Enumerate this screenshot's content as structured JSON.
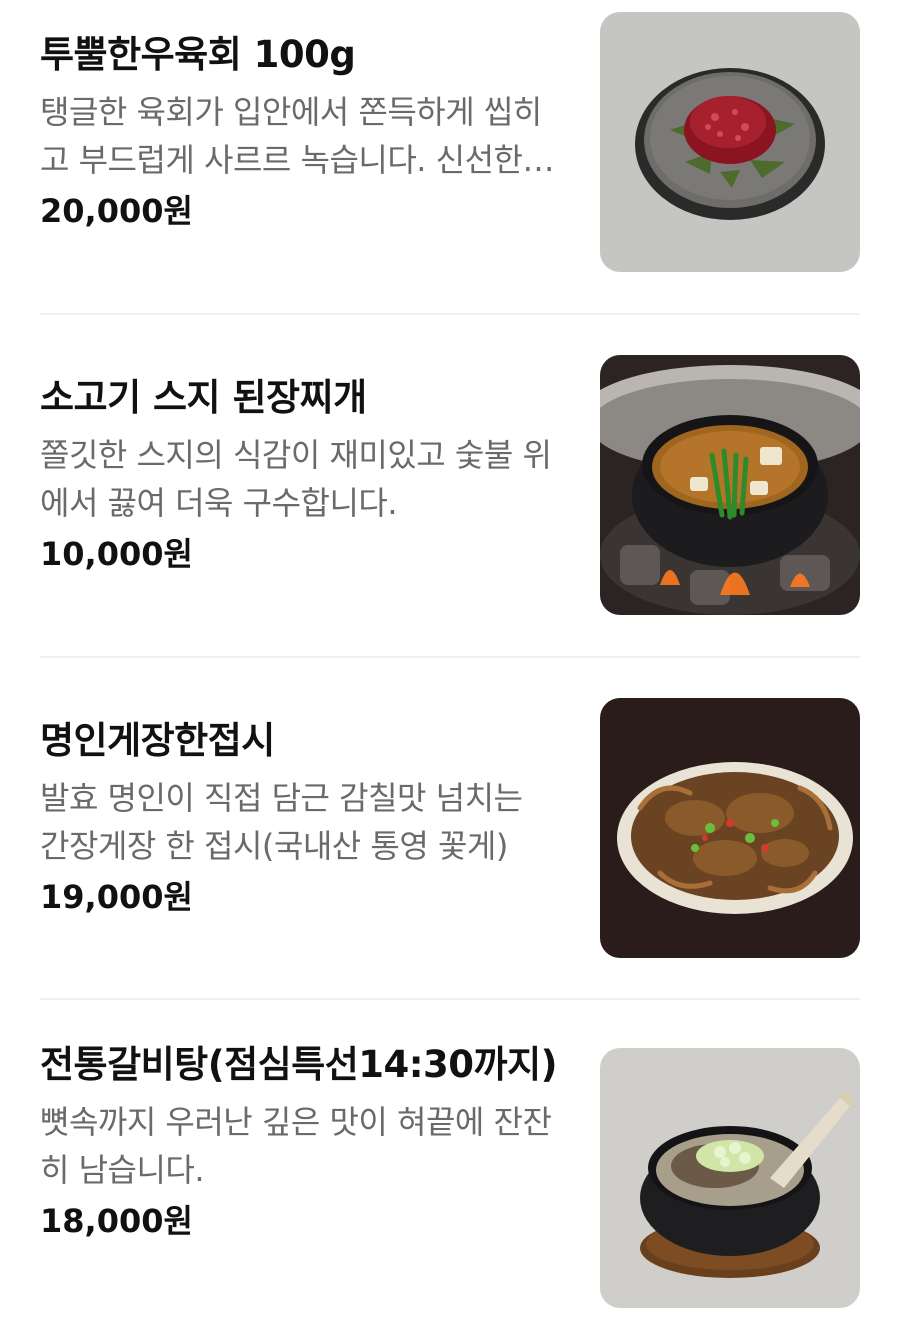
{
  "menu": {
    "items": [
      {
        "name": "투뿔한우육회 100g",
        "description": "탱글한 육회가 입안에서 쫀득하게 씹히고 부드럽게 사르르 녹습니다. 신선한 한우 육회",
        "price": "20,000원",
        "image": "yukhoe-photo"
      },
      {
        "name": "소고기 스지 된장찌개",
        "description": "쫄깃한 스지의 식감이 재미있고 숯불 위에서 끓여 더욱 구수합니다.",
        "price": "10,000원",
        "image": "doenjang-jjigae-photo"
      },
      {
        "name": "명인게장한접시",
        "description": "발효 명인이 직접 담근 감칠맛 넘치는 간장게장 한 접시(국내산 통영 꽃게)",
        "price": "19,000원",
        "image": "gejang-photo"
      },
      {
        "name": "전통갈비탕(점심특선14:30까지)",
        "description": "뼛속까지 우러난 깊은 맛이 혀끝에 잔잔히 남습니다.",
        "price": "18,000원",
        "image": "galbitang-photo"
      }
    ]
  },
  "colors": {
    "title": "#111111",
    "description": "#6a6a6a",
    "divider": "#f0f0f0"
  }
}
